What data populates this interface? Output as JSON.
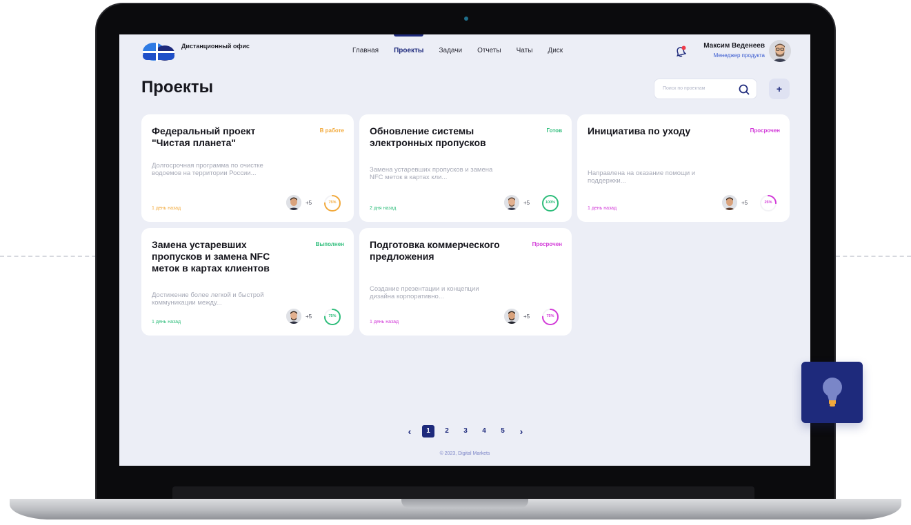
{
  "app": {
    "title": "Дистанционный офис"
  },
  "nav": {
    "items": [
      {
        "label": "Главная",
        "active": false
      },
      {
        "label": "Проекты",
        "active": true
      },
      {
        "label": "Задачи",
        "active": false
      },
      {
        "label": "Отчеты",
        "active": false
      },
      {
        "label": "Чаты",
        "active": false
      },
      {
        "label": "Диск",
        "active": false
      }
    ]
  },
  "user": {
    "name": "Максим Веденеев",
    "role": "Менеджер продукта",
    "has_notification": true
  },
  "page": {
    "title": "Проекты",
    "search_placeholder": "Поиск по проектам",
    "add_label": "+"
  },
  "cards": [
    {
      "title": "Федеральный проект \"Чистая планета\"",
      "status": "В работе",
      "status_color": "#f2a93b",
      "description": "Долгосрочная программа по очистке водоемов на территории России...",
      "date": "1 день назад",
      "extra_members": "+5",
      "progress_label": "75%",
      "progress": 0.75,
      "ring_color": "#f2a93b"
    },
    {
      "title": "Обновление системы электронных пропусков",
      "status": "Готов",
      "status_color": "#2dbd7a",
      "description": "Замена устаревших пропусков и замена NFC меток в картах кли...",
      "date": "2 дня назад",
      "extra_members": "+5",
      "progress_label": "100%",
      "progress": 1.0,
      "ring_color": "#2dbd7a"
    },
    {
      "title": "Инициатива по уходу",
      "status": "Просрочен",
      "status_color": "#d23ad8",
      "description": "Направлена на оказание помощи и поддержки...",
      "date": "1 день назад",
      "extra_members": "+5",
      "progress_label": "25%",
      "progress": 0.25,
      "ring_color": "#d23ad8"
    },
    {
      "title": "Замена устаревших пропусков и замена NFC меток в картах клиентов",
      "status": "Выполнен",
      "status_color": "#2dbd7a",
      "description": "Достижение более легкой и быстрой коммуникации между...",
      "date": "1 день назад",
      "extra_members": "+5",
      "progress_label": "75%",
      "progress": 0.75,
      "ring_color": "#2dbd7a"
    },
    {
      "title": "Подготовка коммерческого предложения",
      "status": "Просрочен",
      "status_color": "#d23ad8",
      "description": "Создание презентации и концепции дизайна корпоративно...",
      "date": "1 день назад",
      "extra_members": "+5",
      "progress_label": "75%",
      "progress": 0.75,
      "ring_color": "#d23ad8"
    }
  ],
  "pagination": {
    "prev": "‹",
    "next": "›",
    "pages": [
      "1",
      "2",
      "3",
      "4",
      "5"
    ],
    "current": "1"
  },
  "footer": {
    "text": "© 2023, Digital Markets"
  },
  "colors": {
    "brand": "#1e2a7c",
    "background": "#eceef6",
    "accent_blue": "#3a5bd0"
  }
}
